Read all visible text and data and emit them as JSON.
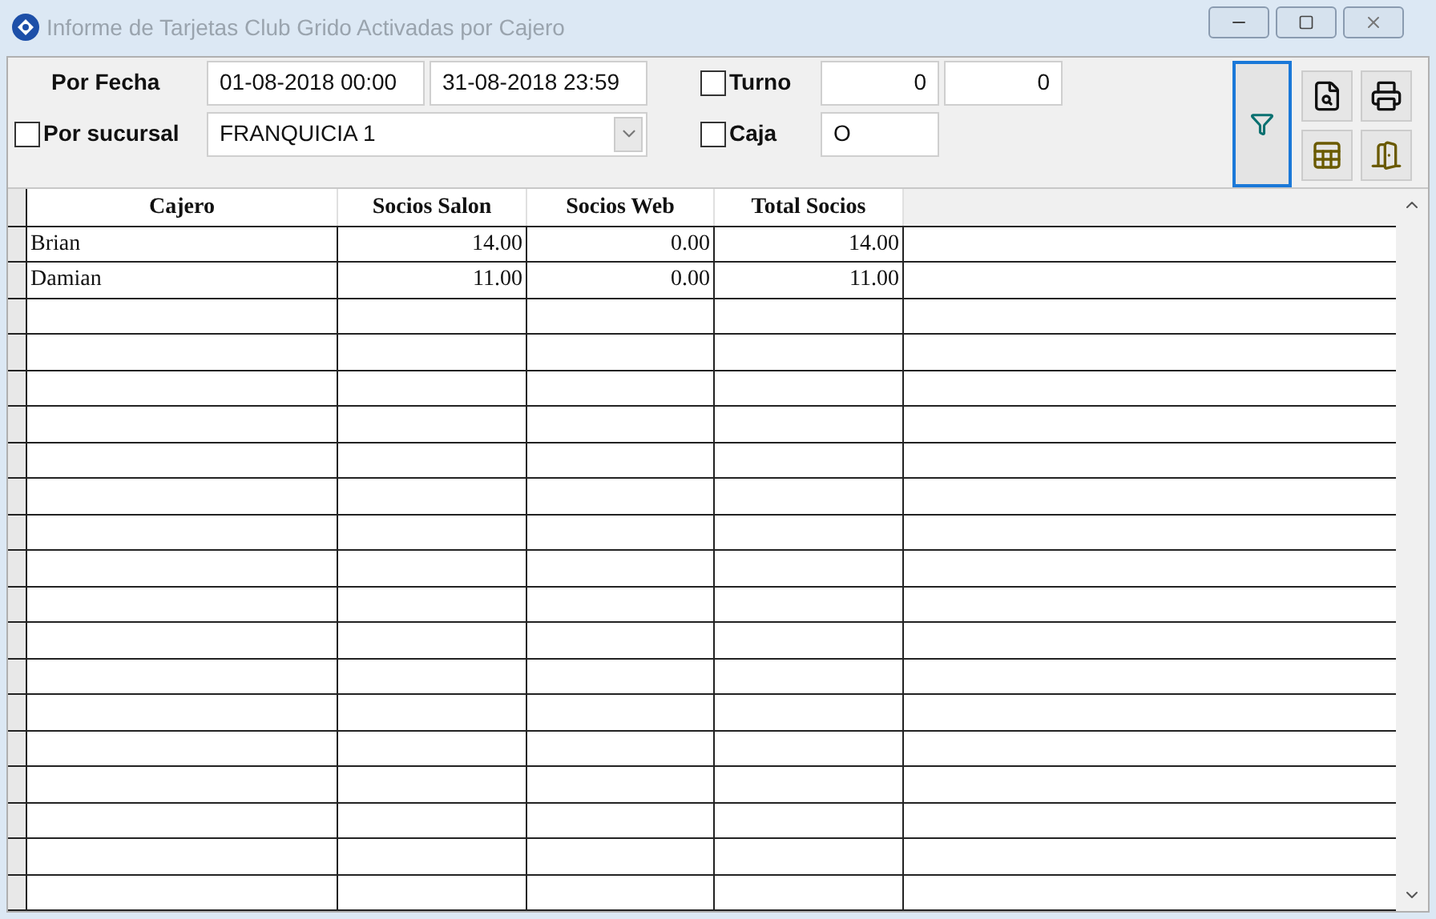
{
  "window": {
    "title": "Informe de Tarjetas Club Grido Activadas por Cajero"
  },
  "filters": {
    "fecha_label": "Por Fecha",
    "fecha_desde": "01-08-2018 00:00",
    "fecha_hasta": "31-08-2018 23:59",
    "sucursal": {
      "label": "Por sucursal",
      "checked": false,
      "value": "FRANQUICIA 1"
    },
    "turno": {
      "label": "Turno",
      "checked": false,
      "desde": "0",
      "hasta": "0"
    },
    "caja": {
      "label": "Caja",
      "checked": false,
      "value": "O"
    }
  },
  "table": {
    "columns": [
      "Cajero",
      "Socios Salon",
      "Socios Web",
      "Total Socios"
    ],
    "rows": [
      {
        "cells": [
          "Brian",
          "14.00",
          "0.00",
          "14.00"
        ]
      },
      {
        "cells": [
          "Damian",
          "11.00",
          "0.00",
          "11.00"
        ]
      }
    ]
  }
}
